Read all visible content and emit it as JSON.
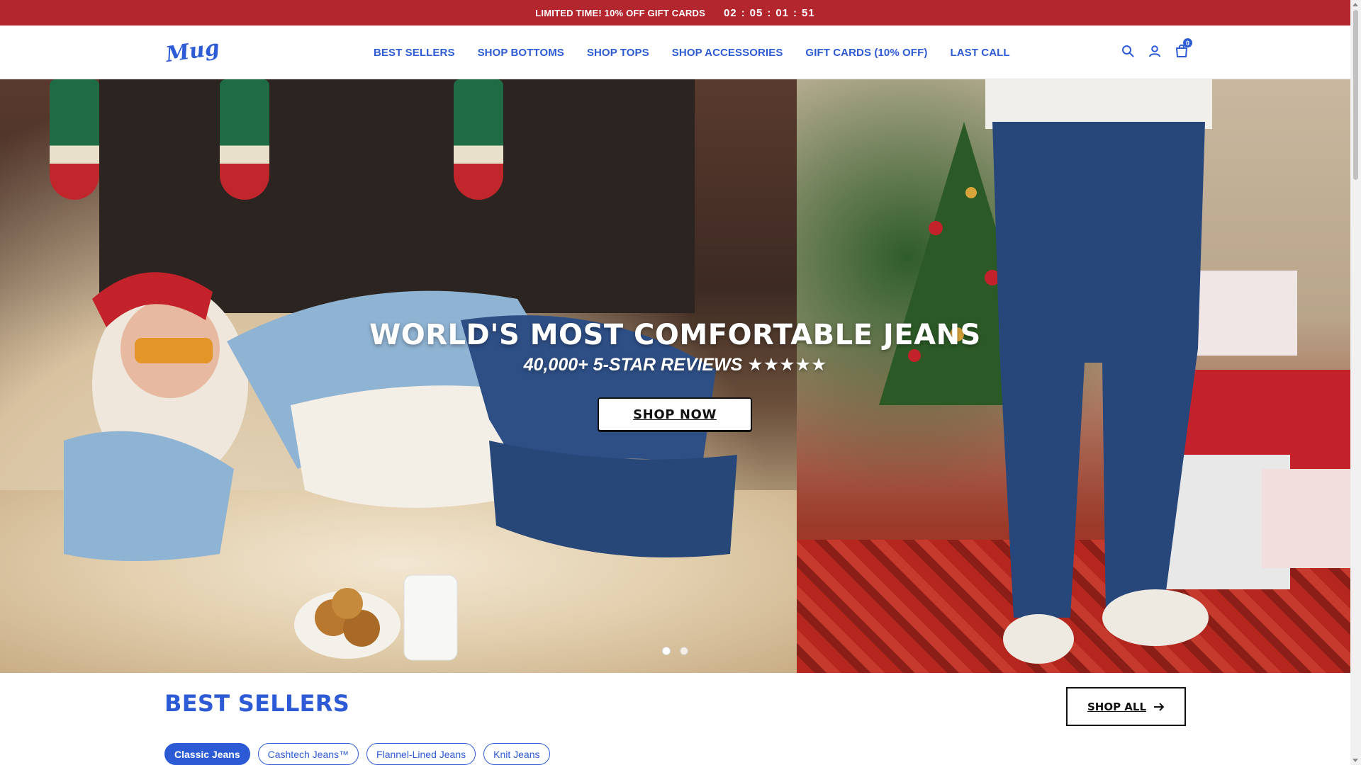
{
  "announcement": {
    "text": "LIMITED TIME! 10% OFF GIFT CARDS",
    "timer": {
      "hours": "02",
      "minutes": "05",
      "seconds": "01",
      "frames": "51",
      "separator": ":"
    }
  },
  "header": {
    "logo_text": "Mugsy",
    "nav": [
      {
        "label": "BEST SELLERS"
      },
      {
        "label": "SHOP BOTTOMS"
      },
      {
        "label": "SHOP TOPS"
      },
      {
        "label": "SHOP ACCESSORIES"
      },
      {
        "label": "GIFT CARDS (10% OFF)"
      },
      {
        "label": "LAST CALL"
      }
    ],
    "icons": {
      "search": "search-icon",
      "account": "user-icon",
      "cart": "cart-icon"
    },
    "cart_count": "0"
  },
  "hero": {
    "title": "WORLD'S MOST COMFORTABLE JEANS",
    "subtitle": "40,000+ 5-STAR REVIEWS ★★★★★",
    "cta": "SHOP NOW",
    "slide_count": 2,
    "active_slide": 1
  },
  "best_sellers": {
    "title": "BEST SELLERS",
    "shop_all": "SHOP ALL",
    "filters": [
      {
        "label": "Classic Jeans",
        "active": true
      },
      {
        "label": "Cashtech Jeans™",
        "active": false
      },
      {
        "label": "Flannel-Lined Jeans",
        "active": false
      },
      {
        "label": "Knit Jeans",
        "active": false
      }
    ]
  },
  "colors": {
    "announcement_bg": "#b3262e",
    "brand_blue": "#2d5bd6"
  }
}
